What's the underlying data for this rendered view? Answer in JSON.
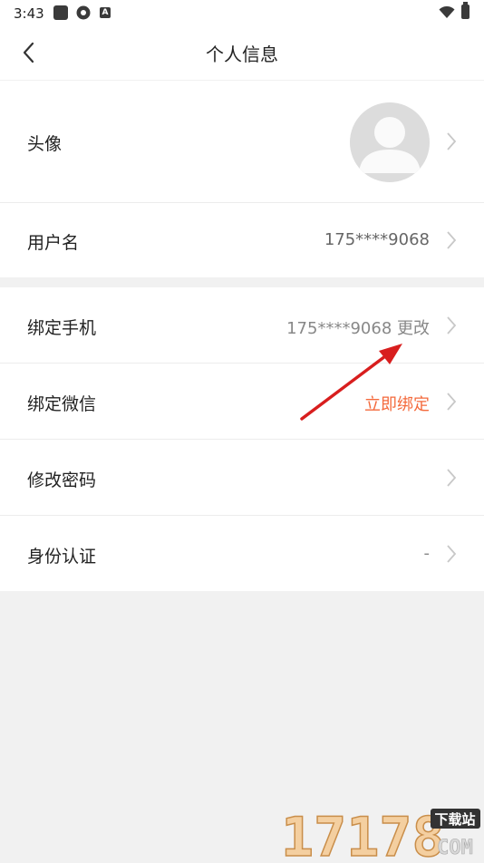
{
  "status_bar": {
    "time": "3:43"
  },
  "header": {
    "title": "个人信息"
  },
  "rows": {
    "avatar": {
      "label": "头像"
    },
    "username": {
      "label": "用户名",
      "value": "175****9068"
    },
    "bind_phone": {
      "label": "绑定手机",
      "value": "175****9068 更改"
    },
    "bind_wechat": {
      "label": "绑定微信",
      "value": "立即绑定"
    },
    "change_password": {
      "label": "修改密码"
    },
    "identity": {
      "label": "身份认证",
      "value": "-"
    }
  },
  "colors": {
    "accent_orange": "#f46a3c",
    "background": "#f1f1f1",
    "arrow_red": "#d81e1e"
  },
  "watermark": {
    "text": "17178",
    "badge": "下载站",
    "suffix": "COM"
  }
}
